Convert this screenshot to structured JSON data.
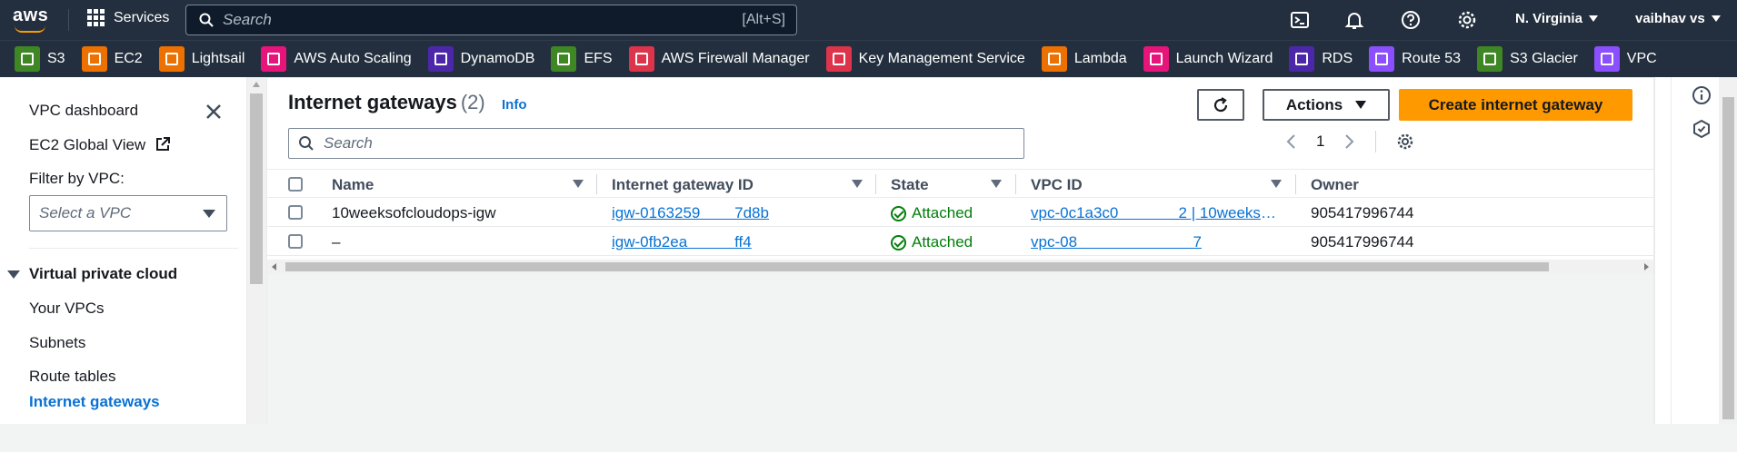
{
  "topnav": {
    "logo": "aws",
    "services_label": "Services",
    "search_placeholder": "Search",
    "search_shortcut": "[Alt+S]",
    "icons": [
      "cloudshell-icon",
      "bell-icon",
      "help-icon",
      "gear-icon"
    ],
    "region": "N. Virginia",
    "user": "vaibhav vs"
  },
  "favorites": [
    {
      "label": "S3",
      "color": "#3f8624"
    },
    {
      "label": "EC2",
      "color": "#ed7100"
    },
    {
      "label": "Lightsail",
      "color": "#ed7100"
    },
    {
      "label": "AWS Auto Scaling",
      "color": "#e7157b"
    },
    {
      "label": "DynamoDB",
      "color": "#4d27aa"
    },
    {
      "label": "EFS",
      "color": "#3f8624"
    },
    {
      "label": "AWS Firewall Manager",
      "color": "#dd344c"
    },
    {
      "label": "Key Management Service",
      "color": "#dd344c"
    },
    {
      "label": "Lambda",
      "color": "#ed7100"
    },
    {
      "label": "Launch Wizard",
      "color": "#e7157b"
    },
    {
      "label": "RDS",
      "color": "#4d27aa"
    },
    {
      "label": "Route 53",
      "color": "#8c4fff"
    },
    {
      "label": "S3 Glacier",
      "color": "#3f8624"
    },
    {
      "label": "VPC",
      "color": "#8c4fff"
    }
  ],
  "sidebar": {
    "dashboard": "VPC dashboard",
    "global_view": "EC2 Global View",
    "filter_label": "Filter by VPC:",
    "select_placeholder": "Select a VPC",
    "section": "Virtual private cloud",
    "items": [
      "Your VPCs",
      "Subnets",
      "Route tables",
      "Internet gateways"
    ]
  },
  "main": {
    "title": "Internet gateways",
    "count": "(2)",
    "info": "Info",
    "actions_label": "Actions",
    "create_label": "Create internet gateway",
    "search_placeholder": "Search",
    "page": "1",
    "columns": [
      "Name",
      "Internet gateway ID",
      "State",
      "VPC ID",
      "Owner"
    ],
    "rows": [
      {
        "name": "10weeksofcloudops-igw",
        "id": "igw-0163259        7d8b",
        "state": "Attached",
        "vpc": "vpc-0c1a3c0              2 | 10weeksofcl...",
        "owner": "905417996744"
      },
      {
        "name": "–",
        "id": "igw-0fb2ea           ff4",
        "state": "Attached",
        "vpc": "vpc-08                           7",
        "owner": "905417996744"
      }
    ]
  },
  "colors": {
    "nav_bg": "#232f3e",
    "accent": "#ff9900",
    "link": "#0972d3",
    "success": "#037f0c"
  }
}
